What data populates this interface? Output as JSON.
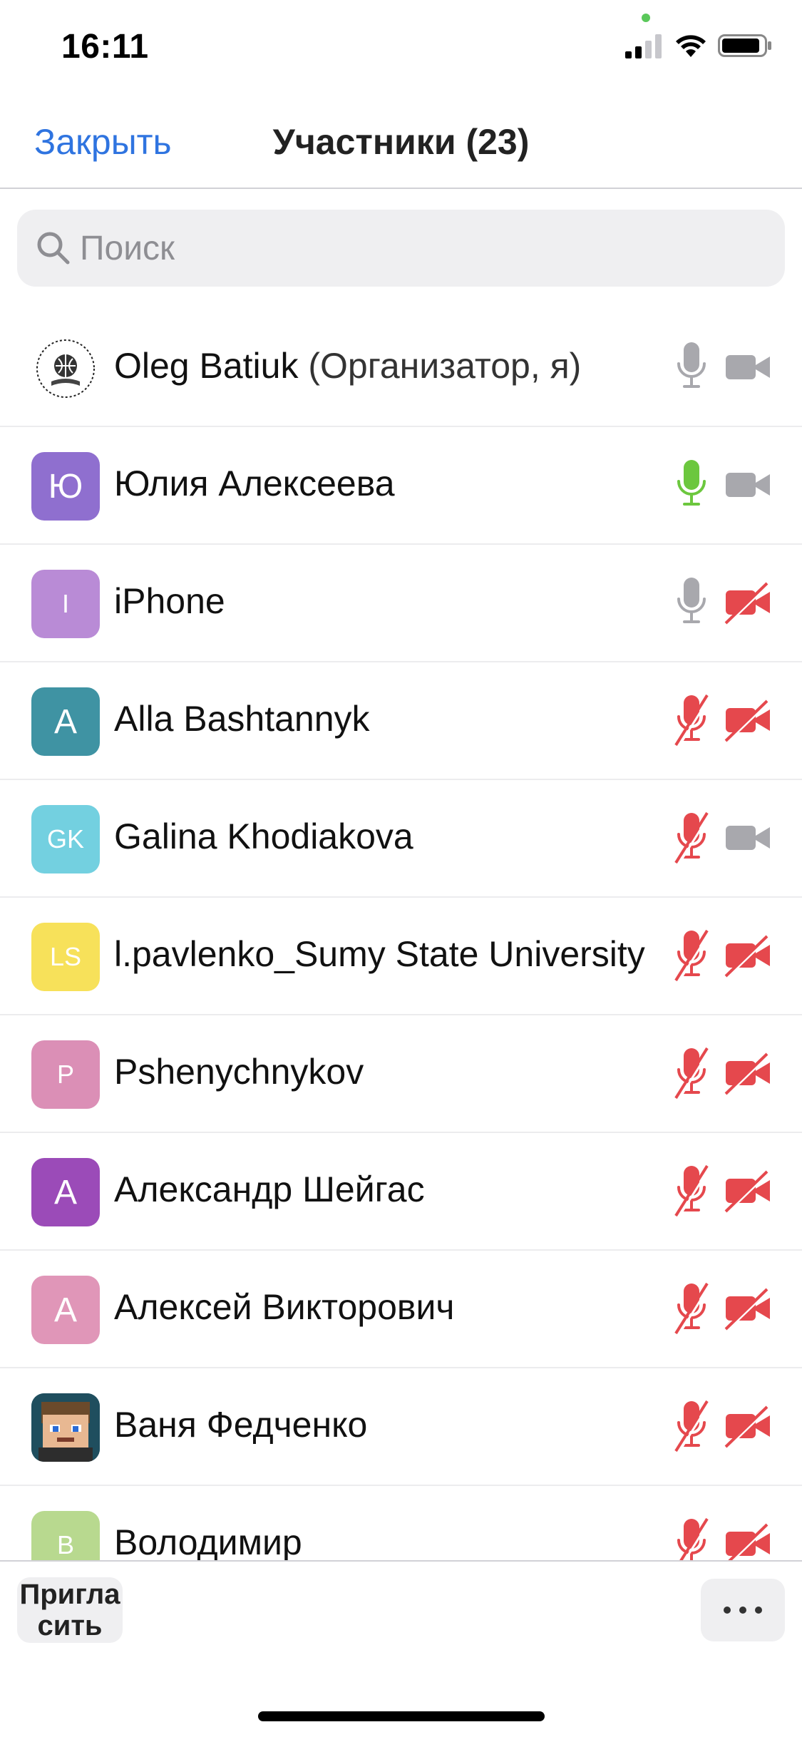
{
  "status_bar": {
    "time": "16:11"
  },
  "nav": {
    "close_label": "Закрыть",
    "title": "Участники (23)"
  },
  "search": {
    "placeholder": "Поиск"
  },
  "colors": {
    "accent": "#2f74e0",
    "muted_gray": "#a8a8ad",
    "muted_red": "#e5484d",
    "active_green": "#6cc73e"
  },
  "participants": [
    {
      "name": "Oleg Batiuk",
      "role": "(Организатор, я)",
      "initials": "",
      "avatar_type": "logo",
      "avatar_color": "#ffffff",
      "mic": "on",
      "camera": "on"
    },
    {
      "name": "Юлия Алексеева",
      "role": "",
      "initials": "Ю",
      "avatar_type": "initials",
      "avatar_color": "#8f6fcf",
      "mic": "active",
      "camera": "on"
    },
    {
      "name": "iPhone",
      "role": "",
      "initials": "I",
      "avatar_type": "initials",
      "avatar_color": "#b98bd6",
      "mic": "on",
      "camera": "off"
    },
    {
      "name": "Alla Bashtannyk",
      "role": "",
      "initials": "A",
      "avatar_type": "initials",
      "avatar_color": "#3f93a3",
      "mic": "off",
      "camera": "off"
    },
    {
      "name": "Galina Khodiakova",
      "role": "",
      "initials": "GK",
      "avatar_type": "initials",
      "avatar_color": "#73d0e0",
      "mic": "off",
      "camera": "on"
    },
    {
      "name": "l.pavlenko_Sumy State University",
      "role": "",
      "initials": "LS",
      "avatar_type": "initials",
      "avatar_color": "#f7e15a",
      "mic": "off",
      "camera": "off"
    },
    {
      "name": "Pshenychnykov",
      "role": "",
      "initials": "P",
      "avatar_type": "initials",
      "avatar_color": "#db8fb6",
      "mic": "off",
      "camera": "off"
    },
    {
      "name": "Александр Шейгас",
      "role": "",
      "initials": "A",
      "avatar_type": "initials",
      "avatar_color": "#9b4bb8",
      "mic": "off",
      "camera": "off"
    },
    {
      "name": "Алексей Викторович",
      "role": "",
      "initials": "A",
      "avatar_type": "initials",
      "avatar_color": "#e096b8",
      "mic": "off",
      "camera": "off"
    },
    {
      "name": "Ваня Федченко",
      "role": "",
      "initials": "",
      "avatar_type": "photo",
      "avatar_color": "#2b6a7a",
      "mic": "off",
      "camera": "off"
    },
    {
      "name": "Володимир",
      "role": "",
      "initials": "B",
      "avatar_type": "initials",
      "avatar_color": "#b8d98f",
      "mic": "off",
      "camera": "off"
    }
  ],
  "toolbar": {
    "invite_label": "Пригласить",
    "more_label": "more"
  }
}
